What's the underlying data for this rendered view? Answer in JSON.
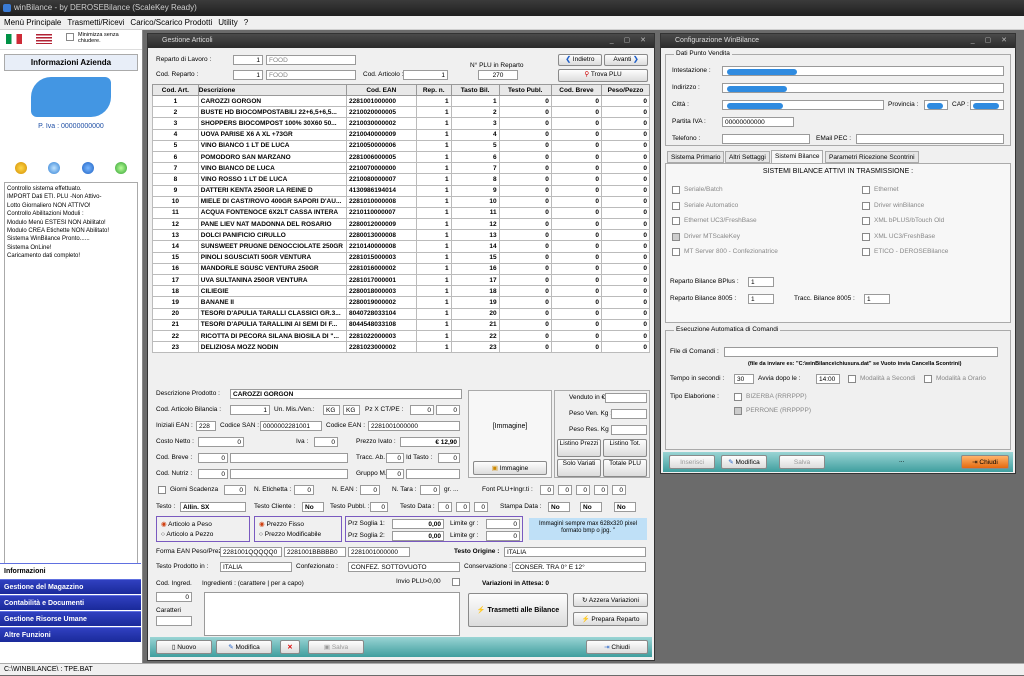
{
  "app": {
    "title": "winBilance - by DEROSEBilance (ScaleKey Ready)"
  },
  "menu": [
    "Menù Principale",
    "Trasmetti/Ricevi",
    "Carico/Scarico Prodotti",
    "Utility",
    "?"
  ],
  "left": {
    "minimize_label": "Minimizza senza chiudere.",
    "info_title": "Informazioni Azienda",
    "piva": "P. Iva : 00000000000",
    "log": [
      "Controllo sistema effettuato.",
      "IMPORT Dati ETI. PLU -Non Attivo-",
      "Lotto Giornaliero NON ATTIVO!",
      "Controllo Abilitazioni Moduli :",
      "Modulo Menù ESTESI NON Abilitato!",
      "Modulo CREA Etichette NON Abilitato!",
      "Sistema WinBilance Pronto......",
      "Sistema OnLine!",
      "Caricamento dati completo!"
    ],
    "nav": [
      "Informazioni",
      "Gestione del Magazzino",
      "Contabilità e Documenti",
      "Gestione Risorse Umane",
      "Altre Funzioni"
    ]
  },
  "status": "C:\\WINBILANCE\\ : TPE.BAT",
  "articoli": {
    "title": "Gestione Articoli",
    "reparto_label": "Reparto di Lavoro :",
    "reparto_num": "1",
    "reparto_name": "FOOD",
    "codrep_label": "Cod. Reparto :",
    "codrep_num": "1",
    "codrep_name": "FOOD",
    "codart_label": "Cod. Articolo :",
    "codart_val": "1",
    "nplu_label": "N° PLU in Reparto",
    "nplu_val": "270",
    "indietro": "Indietro",
    "avanti": "Avanti",
    "trova": "Trova PLU",
    "headers": [
      "Cod. Art.",
      "Descrizione",
      "Cod. EAN",
      "Rep. n.",
      "Tasto Bil.",
      "Testo Publ.",
      "Cod. Breve",
      "Peso/Pezzo"
    ],
    "rows": [
      [
        "1",
        "CAROZZI GORGON",
        "2281001000000",
        "1",
        "1",
        "0",
        "0",
        "0"
      ],
      [
        "2",
        "BUSTE HD BIOCOMPOSTABILI 22+6,5+6,5...",
        "2210020000005",
        "1",
        "2",
        "0",
        "0",
        "0"
      ],
      [
        "3",
        "SHOPPERS BIOCOMPOST 100% 30X60 50...",
        "2210030000002",
        "1",
        "3",
        "0",
        "0",
        "0"
      ],
      [
        "4",
        "UOVA PARISE X6 A XL +73GR",
        "2210040000009",
        "1",
        "4",
        "0",
        "0",
        "0"
      ],
      [
        "5",
        "VINO BIANCO 1 LT DE LUCA",
        "2210050000006",
        "1",
        "5",
        "0",
        "0",
        "0"
      ],
      [
        "6",
        "POMODORO SAN MARZANO",
        "2281006000005",
        "1",
        "6",
        "0",
        "0",
        "0"
      ],
      [
        "7",
        "VINO BIANCO DE LUCA",
        "2210070000000",
        "1",
        "7",
        "0",
        "0",
        "0"
      ],
      [
        "8",
        "VINO ROSSO 1 LT DE LUCA",
        "2210080000007",
        "1",
        "8",
        "0",
        "0",
        "0"
      ],
      [
        "9",
        "DATTERI KENTA 250GR LA REINE D",
        "4130986194014",
        "1",
        "9",
        "0",
        "0",
        "0"
      ],
      [
        "10",
        "MIELE DI CAST/ROVO 400GR SAPORI D'AU...",
        "2281010000008",
        "1",
        "10",
        "0",
        "0",
        "0"
      ],
      [
        "11",
        "ACQUA FONTENOCE 6X2LT CASSA INTERA",
        "2210110000007",
        "1",
        "11",
        "0",
        "0",
        "0"
      ],
      [
        "12",
        "PANE LIEV NAT  MADONNA DEL ROSARIO",
        "2280012000009",
        "1",
        "12",
        "0",
        "0",
        "0"
      ],
      [
        "13",
        "DOLCI PANIFICIO CIRULLO",
        "2280013000008",
        "1",
        "13",
        "0",
        "0",
        "0"
      ],
      [
        "14",
        "SUNSWEET PRUGNE DENOCCIOLATE 250GR",
        "2210140000008",
        "1",
        "14",
        "0",
        "0",
        "0"
      ],
      [
        "15",
        "PINOLI SGUSCIATI 50GR VENTURA",
        "2281015000003",
        "1",
        "15",
        "0",
        "0",
        "0"
      ],
      [
        "16",
        "MANDORLE SGUSC VENTURA 250GR",
        "2281016000002",
        "1",
        "16",
        "0",
        "0",
        "0"
      ],
      [
        "17",
        "UVA SULTANINA 250GR VENTURA",
        "2281017000001",
        "1",
        "17",
        "0",
        "0",
        "0"
      ],
      [
        "18",
        "CILIEGIE",
        "2280018000003",
        "1",
        "18",
        "0",
        "0",
        "0"
      ],
      [
        "19",
        "BANANE II",
        "2280019000002",
        "1",
        "19",
        "0",
        "0",
        "0"
      ],
      [
        "20",
        "TESORI D'APULIA TARALLI CLASSICI GR.3...",
        "8040728033104",
        "1",
        "20",
        "0",
        "0",
        "0"
      ],
      [
        "21",
        "TESORI D'APULIA TARALLINI AI SEMI DI F...",
        "8044548033108",
        "1",
        "21",
        "0",
        "0",
        "0"
      ],
      [
        "22",
        "RICOTTA DI PECORA SILANA BIOSILA DI \"...",
        "2281022000003",
        "1",
        "22",
        "0",
        "0",
        "0"
      ],
      [
        "23",
        "DELIZIOSA MOZZ NODIN",
        "2281023000002",
        "1",
        "23",
        "0",
        "0",
        "0"
      ]
    ],
    "desc_label": "Descrizione Prodotto :",
    "desc_val": "CAROZZI GORGON",
    "codbil_label": "Cod. Articolo Bilancia :",
    "codbil_val": "1",
    "unmis_label": "Un. Mis./Ven.:",
    "unmis1": "KG",
    "unmis2": "KG",
    "pzx_label": "Pz X CT/PE :",
    "pzx1": "0",
    "pzx2": "0",
    "iniziali_label": "Iniziali EAN :",
    "iniziali_val": "228",
    "san_label": "Codice SAN :",
    "san_val": "0000002281001",
    "ean_label": "Codice EAN :",
    "ean_val": "2281001000000",
    "costo_label": "Costo Netto :",
    "costo_val": "0",
    "iva_label": "Iva :",
    "iva_val": "0",
    "prezzo_label": "Prezzo Ivato :",
    "prezzo_val": "€ 12,90",
    "breve_label": "Cod. Breve :",
    "breve_val": "0",
    "tracc_label": "Tracc. Ab. :",
    "tracc_val": "0",
    "idtasto_label": "Id Tasto :",
    "idtasto_val": "0",
    "nutriz_label": "Cod. Nutriz :",
    "nutriz_val": "0",
    "gruppo_label": "Gruppo M. :",
    "gruppo_val": "0",
    "giorni_label": "Giorni Scadenza",
    "giorni_val": "0",
    "neti_label": "N. Etichetta :",
    "neti_val": "0",
    "nean_label": "N. EAN :",
    "nean_val": "0",
    "ntara_label": "N. Tara :",
    "ntara_val": "0",
    "gr_label": "gr. ...",
    "font_label": "Font PLU+Ingr.ti :",
    "font_vals": [
      "0",
      "0",
      "0",
      "0",
      "0"
    ],
    "testo_label": "Testo :",
    "testo_val": "Allin. SX",
    "tcliente_label": "Testo Cliente :",
    "tcliente_val": "No",
    "tpubbl_label": "Testo Pubbl. :",
    "tpubbl_val": "0",
    "tdata_label": "Testo Data :",
    "tdata_vals": [
      "0",
      "0",
      "0"
    ],
    "stampa_label": "Stampa Data :",
    "stampa_vals": [
      "No",
      "No",
      "No"
    ],
    "r_peso": "Articolo a Peso",
    "r_pezzo": "Articolo a Pezzo",
    "r_fisso": "Prezzo Fisso",
    "r_modif": "Prezzo Modificabile",
    "soglia1_label": "Prz Soglia 1:",
    "soglia1_val": "0,00",
    "soglia2_label": "Prz Soglia 2:",
    "soglia2_val": "0,00",
    "limite_label": "Limite gr :",
    "limite1": "0",
    "limite2": "0",
    "img_note": "Immaginì sempre max 628x320 pixel formato bmp o jpg. \"",
    "forma_label": "Forma EAN Peso/Prezzo/PZ",
    "forma_vals": [
      "2281001QQQQQ0",
      "2281001BBBBB0",
      "2281001000000"
    ],
    "origine_label": "Testo Origine :",
    "origine_val": "ITALIA",
    "prodotto_label": "Testo Prodotto in :",
    "prodotto_val": "ITALIA",
    "confez_label": "Confezionato :",
    "confez_val": "CONFEZ. SOTTOVUOTO",
    "conserv_label": "Conservazione :",
    "conserv_val": "CONSER. TRA 0° E 12°",
    "ingred_label": "Cod. Ingred.",
    "ingred_text": "Ingredienti : (carattere | per a capo)",
    "invio_label": "Invio PLU>0,00",
    "variaz_label": "Variazioni in Attesa: 0",
    "ingred_val": "0",
    "caratteri_label": "Caratteri",
    "immagine_label": "[Immagine]",
    "immagine_btn": "Immagine",
    "venduto_label": "Venduto in €:",
    "pesoven_label": "Peso Ven. Kg :",
    "pesores_label": "Peso Res. Kg :",
    "listino_prezzi": "Listino Prezzi",
    "listino_tot": "Listino Tot.",
    "solo_variati": "Solo Variati",
    "totale_plu": "Totale PLU",
    "trasmetti": "Trasmetti alle Bilance",
    "azzera": "Azzera Variazioni",
    "prepara": "Prepara Reparto",
    "nuovo": "Nuovo",
    "modifica": "Modifica",
    "salva": "Salva",
    "chiudi": "Chiudi"
  },
  "config": {
    "title": "Configurazione WinBilance",
    "dati_label": "Dati Punto Vendita",
    "intestazione": "Intestazione :",
    "indirizzo": "Indirizzo :",
    "citta": "Città :",
    "provincia": "Provincia :",
    "cap": "CAP :",
    "partita_label": "Partita IVA :",
    "partita_val": "00000000000",
    "telefono": "Telefono :",
    "email": "EMail PEC :",
    "tabs": [
      "Sistema Primario",
      "Altri Settaggi",
      "Sistemi Bilance",
      "Parametri Ricezione Scontrini"
    ],
    "sys_title": "SISTEMI BILANCE ATTIVI IN TRASMISSIONE :",
    "systems_left": [
      "Seriale/Batch",
      "Seriale Automatico",
      "Ethernet UC3/FreshBase",
      "Driver MTScaleKey",
      "MT Server 800 - Confezionatrice"
    ],
    "systems_right": [
      "Ethernet",
      "Driver winBilance",
      "XML bPLUS/bTouch Old",
      "XML UC3/FreshBase",
      "ETICO - DEROSEBilance"
    ],
    "bplus_label": "Reparto Bilance BPlus :",
    "bplus_val": "1",
    "b8005_label": "Reparto Bilance 8005 :",
    "b8005_val": "1",
    "tracc_label": "Tracc. Bilance 8005 :",
    "tracc_val": "1",
    "esec_label": "Esecuzione Automatica di Comandi",
    "file_label": "File di Comandi :",
    "file_note": "(file da inviare es: \"C:\\winBilance\\chiusura.dat\" se Vuoto invia Cancella Scontrini)",
    "tempo_label": "Tempo in secondi :",
    "tempo_val": "30",
    "avvia_label": "Avvia dopo le :",
    "avvia_val": "14:00",
    "mod_sec": "Modalità a Secondi",
    "mod_ora": "Modalità a Orario",
    "tipo_label": "Tipo Elaborione :",
    "tipo1": "BIZERBA (RRRPPP)",
    "tipo2": "PERRONE (RRPPPP)",
    "inserisci": "Inserisci",
    "modifica": "Modifica",
    "salva": "Salva",
    "dots": "...",
    "chiudi": "Chiudi"
  }
}
